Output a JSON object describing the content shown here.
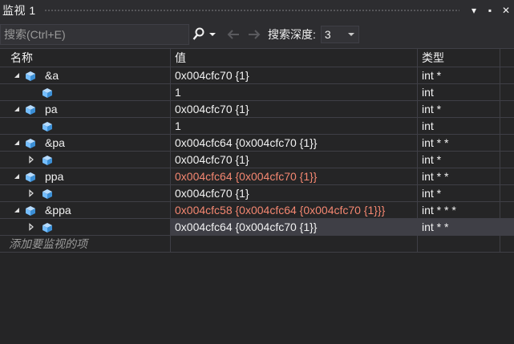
{
  "window": {
    "title": "监视 1",
    "buttons": [
      "▾",
      "▪",
      "✕"
    ]
  },
  "toolbar": {
    "search_placeholder": "搜索(Ctrl+E)",
    "depth_label": "搜索深度:",
    "depth_value": "3"
  },
  "columns": {
    "name": "名称",
    "value": "值",
    "type": "类型"
  },
  "rows": [
    {
      "name": "&a",
      "value": "0x004cfc70 {1}",
      "type": "int *",
      "level": 0,
      "expander": "expanded",
      "changed": false
    },
    {
      "name": "",
      "value": "1",
      "type": "int",
      "level": 1,
      "expander": "none",
      "changed": false
    },
    {
      "name": "pa",
      "value": "0x004cfc70 {1}",
      "type": "int *",
      "level": 0,
      "expander": "expanded",
      "changed": false
    },
    {
      "name": "",
      "value": "1",
      "type": "int",
      "level": 1,
      "expander": "none",
      "changed": false
    },
    {
      "name": "&pa",
      "value": "0x004cfc64 {0x004cfc70 {1}}",
      "type": "int * *",
      "level": 0,
      "expander": "expanded",
      "changed": false
    },
    {
      "name": "",
      "value": "0x004cfc70 {1}",
      "type": "int *",
      "level": 1,
      "expander": "collapsed",
      "changed": false
    },
    {
      "name": "ppa",
      "value": "0x004cfc64 {0x004cfc70 {1}}",
      "type": "int * *",
      "level": 0,
      "expander": "expanded",
      "changed": true
    },
    {
      "name": "",
      "value": "0x004cfc70 {1}",
      "type": "int *",
      "level": 1,
      "expander": "collapsed",
      "changed": false
    },
    {
      "name": "&ppa",
      "value": "0x004cfc58 {0x004cfc64 {0x004cfc70 {1}}}",
      "type": "int * * *",
      "level": 0,
      "expander": "expanded",
      "changed": true
    },
    {
      "name": "",
      "value": "0x004cfc64 {0x004cfc70 {1}}",
      "type": "int * *",
      "level": 1,
      "expander": "collapsed",
      "changed": false,
      "selected": true
    }
  ],
  "add_item_placeholder": "添加要监视的项",
  "colors": {
    "background": "#252526",
    "changed_value": "#f48771",
    "cube_icon": "#75beff",
    "selected_row": "#3f3f46"
  }
}
